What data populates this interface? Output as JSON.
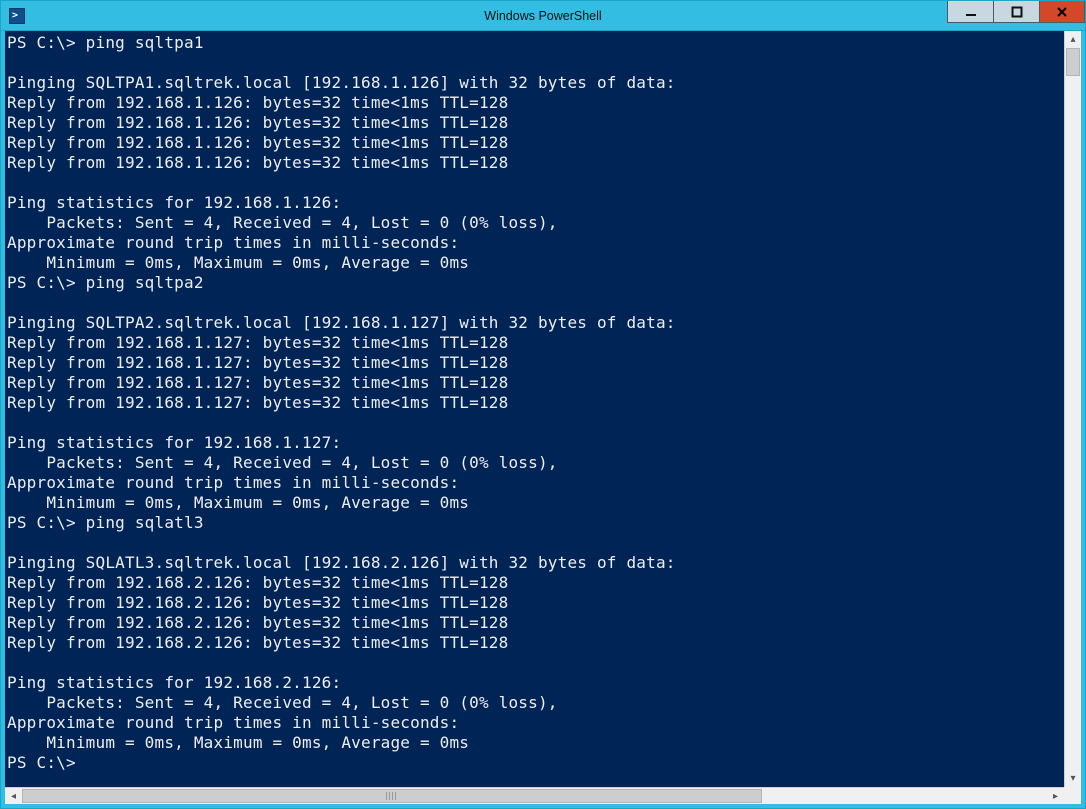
{
  "window": {
    "title": "Windows PowerShell"
  },
  "prompt": "PS C:\\>",
  "pings": [
    {
      "command": "ping sqltpa1",
      "host_fqdn": "SQLTPA1.sqltrek.local",
      "ip": "192.168.1.126",
      "bytes": 32,
      "replies": [
        {
          "from": "192.168.1.126",
          "bytes": 32,
          "time": "<1ms",
          "ttl": 128
        },
        {
          "from": "192.168.1.126",
          "bytes": 32,
          "time": "<1ms",
          "ttl": 128
        },
        {
          "from": "192.168.1.126",
          "bytes": 32,
          "time": "<1ms",
          "ttl": 128
        },
        {
          "from": "192.168.1.126",
          "bytes": 32,
          "time": "<1ms",
          "ttl": 128
        }
      ],
      "stats": {
        "sent": 4,
        "received": 4,
        "lost": 0,
        "loss_pct": 0,
        "min_ms": 0,
        "max_ms": 0,
        "avg_ms": 0
      }
    },
    {
      "command": "ping sqltpa2",
      "host_fqdn": "SQLTPA2.sqltrek.local",
      "ip": "192.168.1.127",
      "bytes": 32,
      "replies": [
        {
          "from": "192.168.1.127",
          "bytes": 32,
          "time": "<1ms",
          "ttl": 128
        },
        {
          "from": "192.168.1.127",
          "bytes": 32,
          "time": "<1ms",
          "ttl": 128
        },
        {
          "from": "192.168.1.127",
          "bytes": 32,
          "time": "<1ms",
          "ttl": 128
        },
        {
          "from": "192.168.1.127",
          "bytes": 32,
          "time": "<1ms",
          "ttl": 128
        }
      ],
      "stats": {
        "sent": 4,
        "received": 4,
        "lost": 0,
        "loss_pct": 0,
        "min_ms": 0,
        "max_ms": 0,
        "avg_ms": 0
      }
    },
    {
      "command": "ping sqlatl3",
      "host_fqdn": "SQLATL3.sqltrek.local",
      "ip": "192.168.2.126",
      "bytes": 32,
      "replies": [
        {
          "from": "192.168.2.126",
          "bytes": 32,
          "time": "<1ms",
          "ttl": 128
        },
        {
          "from": "192.168.2.126",
          "bytes": 32,
          "time": "<1ms",
          "ttl": 128
        },
        {
          "from": "192.168.2.126",
          "bytes": 32,
          "time": "<1ms",
          "ttl": 128
        },
        {
          "from": "192.168.2.126",
          "bytes": 32,
          "time": "<1ms",
          "ttl": 128
        }
      ],
      "stats": {
        "sent": 4,
        "received": 4,
        "lost": 0,
        "loss_pct": 0,
        "min_ms": 0,
        "max_ms": 0,
        "avg_ms": 0
      }
    }
  ],
  "final_prompt": "PS C:\\>"
}
